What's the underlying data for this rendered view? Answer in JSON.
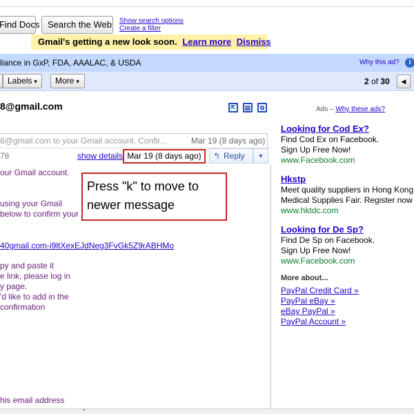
{
  "top": {
    "find_docs_label": "Find Docs",
    "search_web_label": "Search the Web",
    "show_search_options": "Show search options",
    "create_filter": "Create a filter"
  },
  "notice": {
    "text": "Gmail's getting a new look soon.",
    "learn_more": "Learn more",
    "dismiss": "Dismiss"
  },
  "ad_bar": {
    "text": "liance in GxP, FDA, AAALAC, & USDA",
    "why_this_ad": "Why this ad?",
    "info_icon": "info-icon"
  },
  "toolbar": {
    "labels_label": "Labels",
    "more_label": "More",
    "caret": "▾",
    "pager_current": "2",
    "pager_of": "of",
    "pager_total": "30",
    "prev_icon": "◀"
  },
  "thread": {
    "sender": "8@gmail.com",
    "icons": [
      "new-window-icon",
      "print-icon",
      "expand-all-icon"
    ]
  },
  "collapsed_message": {
    "snippet": "8@gmail.com to your Gmail account. Confir...",
    "date": "Mar 19 (8 days ago)"
  },
  "open_message": {
    "sender_fragment": "78",
    "show_details": "show details",
    "date": "Mar 19 (8 days ago)",
    "reply_label": "Reply",
    "reply_arrow": "↰",
    "dropdown_caret": "▼"
  },
  "body": {
    "line1": "our Gmail account.",
    "line2": "using your Gmail",
    "line3": "below to confirm your",
    "link": "40gmail.com-i9ltXexEJdNeg3FvGk5Z9rABHMo",
    "line4": "py and paste it",
    "line5": "e link, please log in",
    "line6": "y page.",
    "line7": "'d like to add in the",
    "line8": "confirmation",
    "line9": "his email address"
  },
  "callout": {
    "text": "Press \"k\" to move to newer message"
  },
  "ads": {
    "header_prefix": "Ads –",
    "header_link": "Why these ads?",
    "items": [
      {
        "title": "Looking for Cod Ex?",
        "line1": "Find Cod Ex on Facebook.",
        "line2": "Sign Up Free Now!",
        "url": "www.Facebook.com"
      },
      {
        "title": "Hkstp",
        "line1": "Meet quality suppliers in Hong Kong",
        "line2": "Medical Supplies Fair. Register now",
        "url": "www.hktdc.com"
      },
      {
        "title": "Looking for De Sp?",
        "line1": "Find De Sp on Facebook.",
        "line2": "Sign Up Free Now!",
        "url": "www.Facebook.com"
      }
    ],
    "more_about": "More about...",
    "more_links": [
      "PayPal Credit Card »",
      "PayPal eBay »",
      "eBay PayPal »",
      "PayPal Account »"
    ]
  },
  "scrollbar": {
    "grip": "'''"
  }
}
